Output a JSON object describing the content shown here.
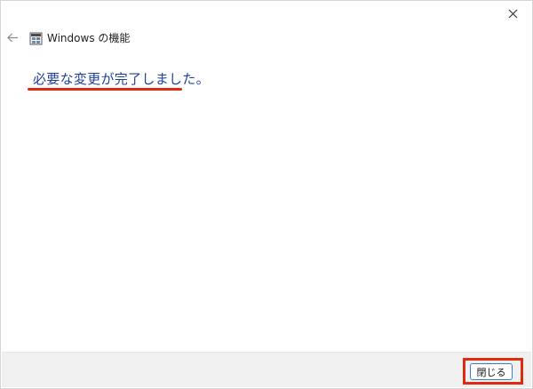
{
  "window": {
    "title": "Windows の機能",
    "close_icon": "close-icon",
    "back_icon": "back-arrow-icon",
    "app_icon": "windows-features-icon"
  },
  "main": {
    "status_message": "必要な変更が完了しました。"
  },
  "footer": {
    "close_button_label": "閉じる"
  },
  "colors": {
    "status_text": "#1f3f9a",
    "annotation": "#e02a10",
    "button_border": "#3b7bd6",
    "footer_bg": "#f0f0f0"
  }
}
